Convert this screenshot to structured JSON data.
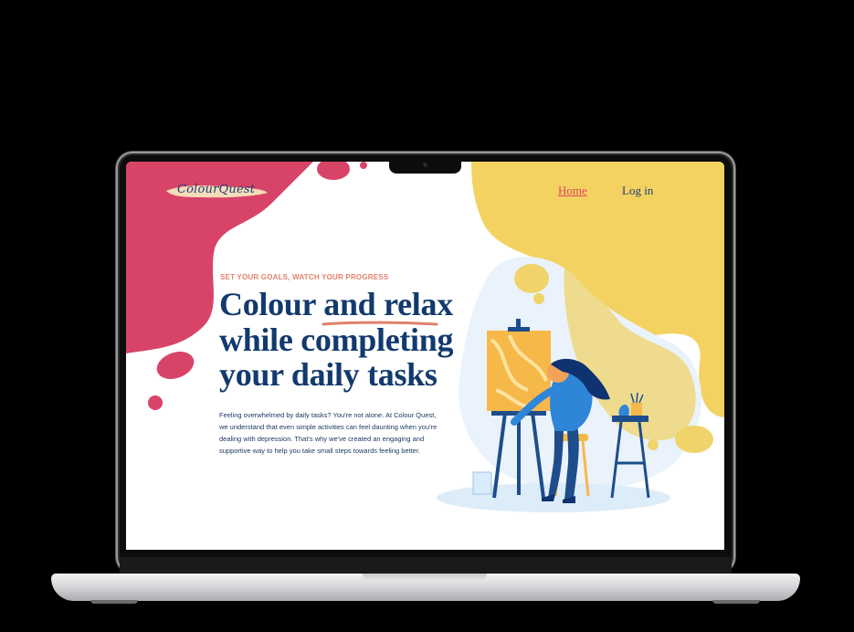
{
  "logo": {
    "text": "ColourQuest"
  },
  "nav": {
    "home": "Home",
    "login": "Log in"
  },
  "hero": {
    "eyebrow": "SET YOUR GOALS,  WATCH YOUR PROGRESS",
    "headline": [
      "Colour and relax",
      "while completing",
      "your daily tasks"
    ],
    "body": "Feeling overwhelmed by daily tasks? You're not alone. At Colour Quest, we understand that even simple activities can feel daunting when you're dealing with depression. That's why we've created an engaging and supportive way to help you take small steps towards feeling better."
  },
  "colors": {
    "brand_pink": "#d84468",
    "brand_yellow": "#f3d262",
    "brand_navy": "#123a6e",
    "accent_salmon": "#e2816b",
    "illustration_blue": "#2f86d9"
  }
}
